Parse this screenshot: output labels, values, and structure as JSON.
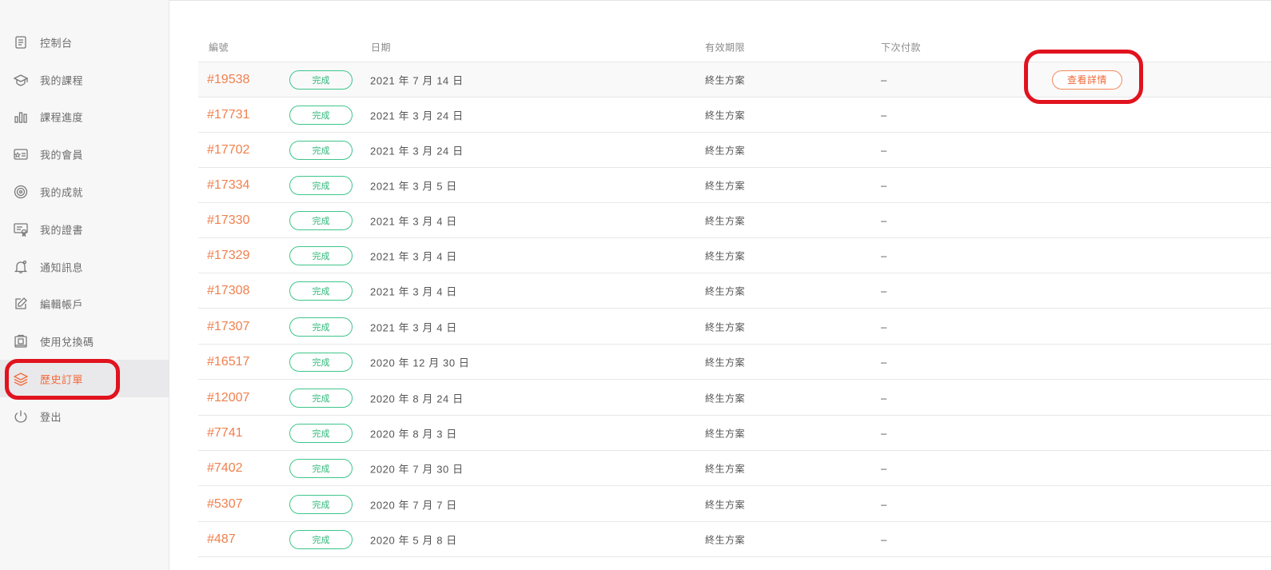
{
  "sidebar": {
    "items": [
      {
        "label": "控制台",
        "icon": "dashboard-icon"
      },
      {
        "label": "我的課程",
        "icon": "graduation-cap-icon"
      },
      {
        "label": "課程進度",
        "icon": "bar-chart-icon"
      },
      {
        "label": "我的會員",
        "icon": "member-card-icon"
      },
      {
        "label": "我的成就",
        "icon": "target-icon"
      },
      {
        "label": "我的證書",
        "icon": "certificate-icon"
      },
      {
        "label": "通知訊息",
        "icon": "bell-icon"
      },
      {
        "label": "編輯帳戶",
        "icon": "edit-icon"
      },
      {
        "label": "使用兌換碼",
        "icon": "redeem-icon"
      },
      {
        "label": "歷史訂單",
        "icon": "layers-icon",
        "active": true
      },
      {
        "label": "登出",
        "icon": "power-icon"
      }
    ]
  },
  "table": {
    "headers": {
      "id": "編號",
      "date": "日期",
      "expiry": "有效期限",
      "next_payment": "下次付款"
    },
    "detail_button": "查看詳情",
    "rows": [
      {
        "id": "#19538",
        "status": "完成",
        "date": "2021 年 7 月 14 日",
        "expiry": "終生方案",
        "next_payment": "–"
      },
      {
        "id": "#17731",
        "status": "完成",
        "date": "2021 年 3 月 24 日",
        "expiry": "終生方案",
        "next_payment": "–"
      },
      {
        "id": "#17702",
        "status": "完成",
        "date": "2021 年 3 月 24 日",
        "expiry": "終生方案",
        "next_payment": "–"
      },
      {
        "id": "#17334",
        "status": "完成",
        "date": "2021 年 3 月 5 日",
        "expiry": "終生方案",
        "next_payment": "–"
      },
      {
        "id": "#17330",
        "status": "完成",
        "date": "2021 年 3 月 4 日",
        "expiry": "終生方案",
        "next_payment": "–"
      },
      {
        "id": "#17329",
        "status": "完成",
        "date": "2021 年 3 月 4 日",
        "expiry": "終生方案",
        "next_payment": "–"
      },
      {
        "id": "#17308",
        "status": "完成",
        "date": "2021 年 3 月 4 日",
        "expiry": "終生方案",
        "next_payment": "–"
      },
      {
        "id": "#17307",
        "status": "完成",
        "date": "2021 年 3 月 4 日",
        "expiry": "終生方案",
        "next_payment": "–"
      },
      {
        "id": "#16517",
        "status": "完成",
        "date": "2020 年 12 月 30 日",
        "expiry": "終生方案",
        "next_payment": "–"
      },
      {
        "id": "#12007",
        "status": "完成",
        "date": "2020 年 8 月 24 日",
        "expiry": "終生方案",
        "next_payment": "–"
      },
      {
        "id": "#7741",
        "status": "完成",
        "date": "2020 年 8 月 3 日",
        "expiry": "終生方案",
        "next_payment": "–"
      },
      {
        "id": "#7402",
        "status": "完成",
        "date": "2020 年 7 月 30 日",
        "expiry": "終生方案",
        "next_payment": "–"
      },
      {
        "id": "#5307",
        "status": "完成",
        "date": "2020 年 7 月 7 日",
        "expiry": "終生方案",
        "next_payment": "–"
      },
      {
        "id": "#487",
        "status": "完成",
        "date": "2020 年 5 月 8 日",
        "expiry": "終生方案",
        "next_payment": "–"
      }
    ]
  },
  "colors": {
    "accent": "#f26b3a",
    "status_green": "#2fb87a",
    "highlight_red": "#e0131e"
  }
}
